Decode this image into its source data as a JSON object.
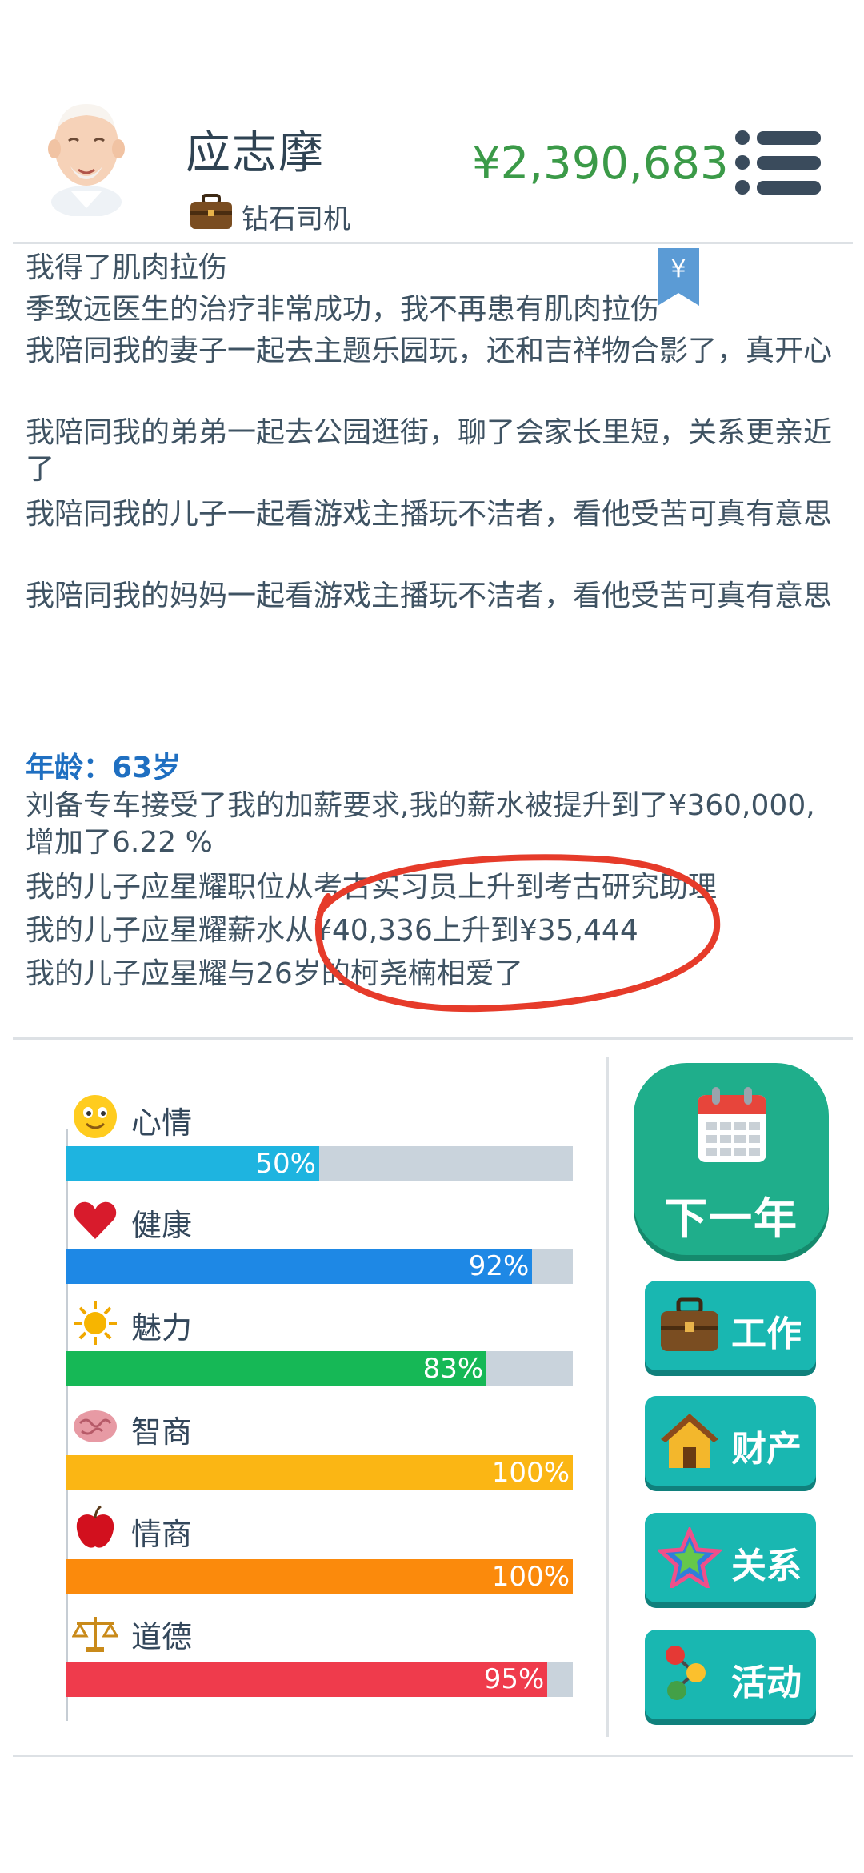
{
  "player": {
    "name": "应志摩",
    "job_title": "钻石司机",
    "money": "¥2,390,683",
    "avatar_icon": "old-man-avatar"
  },
  "bookmark": {
    "symbol": "¥"
  },
  "log": {
    "lines_before": [
      "我得了肌肉拉伤",
      "季致远医生的治疗非常成功，我不再患有肌肉拉伤",
      "我陪同我的妻子一起去主题乐园玩，还和吉祥物合影了，真开心",
      "我陪同我的弟弟一起去公园逛街，聊了会家长里短，关系更亲近了",
      "我陪同我的儿子一起看游戏主播玩不洁者，看他受苦可真有意思",
      "我陪同我的妈妈一起看游戏主播玩不洁者，看他受苦可真有意思"
    ],
    "age_header": "年龄：63岁",
    "lines_after": [
      "刘备专车接受了我的加薪要求,我的薪水被提升到了¥360,000,增加了6.22 %",
      "我的儿子应星耀职位从考古实习员上升到考古研究助理",
      "我的儿子应星耀薪水从¥40,336上升到¥35,444",
      "我的儿子应星耀与26岁的柯尧楠相爱了"
    ]
  },
  "stats": [
    {
      "label": "心情",
      "value": 0.5,
      "text": "50%",
      "color": "#1eb4e0",
      "icon": "smiley-icon"
    },
    {
      "label": "健康",
      "value": 0.92,
      "text": "92%",
      "color": "#1e88e5",
      "icon": "heart-icon"
    },
    {
      "label": "魅力",
      "value": 0.83,
      "text": "83%",
      "color": "#16b856",
      "icon": "sun-icon"
    },
    {
      "label": "智商",
      "value": 1.0,
      "text": "100%",
      "color": "#fbb614",
      "icon": "brain-icon"
    },
    {
      "label": "情商",
      "value": 1.0,
      "text": "100%",
      "color": "#fb8a0c",
      "icon": "apple-icon"
    },
    {
      "label": "道德",
      "value": 0.95,
      "text": "95%",
      "color": "#ef3b4c",
      "icon": "scales-icon"
    }
  ],
  "actions": {
    "next_year": "下一年",
    "work": "工作",
    "property": "财产",
    "relations": "关系",
    "activities": "活动"
  },
  "colors": {
    "money": "#3b9a48",
    "age_header": "#1f6fc1",
    "next_year_button": "#1fae8b",
    "side_button": "#19b7b1",
    "annotation": "#e63b2a"
  }
}
